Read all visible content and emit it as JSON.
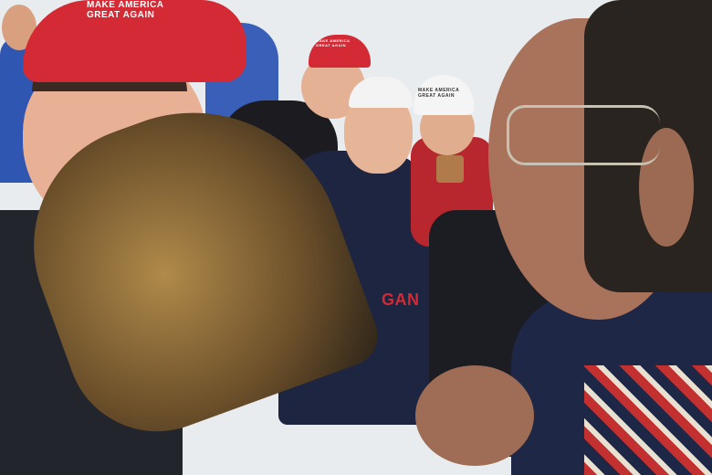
{
  "scene": {
    "colors": {
      "sky": "#e9ecef",
      "red_cap": "#d42a35",
      "white_cap": "#f3f3f3",
      "navy": "#1d2540",
      "skin": "#e2a98a",
      "elder_skin": "#a9725a",
      "drum": "#8a6a3a"
    },
    "caps": [
      {
        "text": "MAKE AMERICA GREAT AGAIN",
        "color": "red"
      },
      {
        "text": "MAKE AMERICA GREAT AGAIN",
        "color": "white"
      },
      {
        "text": "MAKE AMERICA GREAT AGAIN",
        "color": "red"
      }
    ],
    "sweatshirt_text": "GAN"
  }
}
